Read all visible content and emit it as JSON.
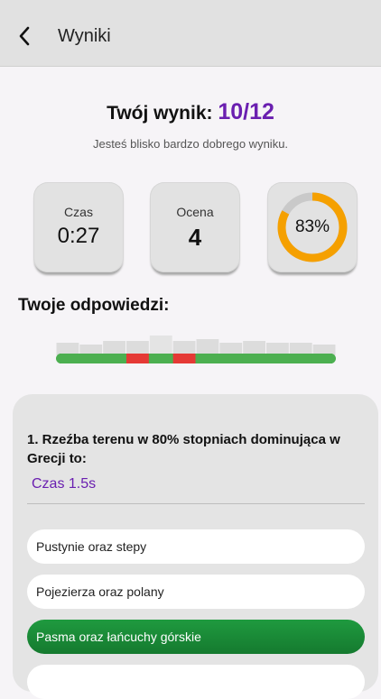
{
  "header": {
    "title": "Wyniki",
    "back_icon": "chevron-left-icon"
  },
  "summary": {
    "score_label": "Twój wynik:",
    "score_value": "10/12",
    "message": "Jesteś blisko bardzo dobrego wyniku."
  },
  "stats": {
    "time_label": "Czas",
    "time_value": "0:27",
    "grade_label": "Ocena",
    "grade_value": "4",
    "percent_value": "83%",
    "percent_fraction": 0.83
  },
  "answers": {
    "heading": "Twoje odpowiedzi:",
    "results": [
      "correct",
      "correct",
      "correct",
      "wrong",
      "correct",
      "wrong",
      "correct",
      "correct",
      "correct",
      "correct",
      "correct",
      "correct"
    ],
    "selected_index": 4
  },
  "question": {
    "text": "1. Rzeźba terenu w 80% stopniach dominująca w Grecji to:",
    "time": "Czas 1.5s",
    "options": [
      {
        "label": "Pustynie oraz stepy",
        "state": "normal"
      },
      {
        "label": "Pojezierza oraz polany",
        "state": "normal"
      },
      {
        "label": "Pasma oraz łańcuchy górskie",
        "state": "correct"
      },
      {
        "label": "",
        "state": "normal"
      }
    ]
  },
  "colors": {
    "accent": "#6a1fb0",
    "correct": "#4caf50",
    "wrong": "#e53935",
    "ring": "#f5a000",
    "ring_track": "#c9c9c9"
  }
}
